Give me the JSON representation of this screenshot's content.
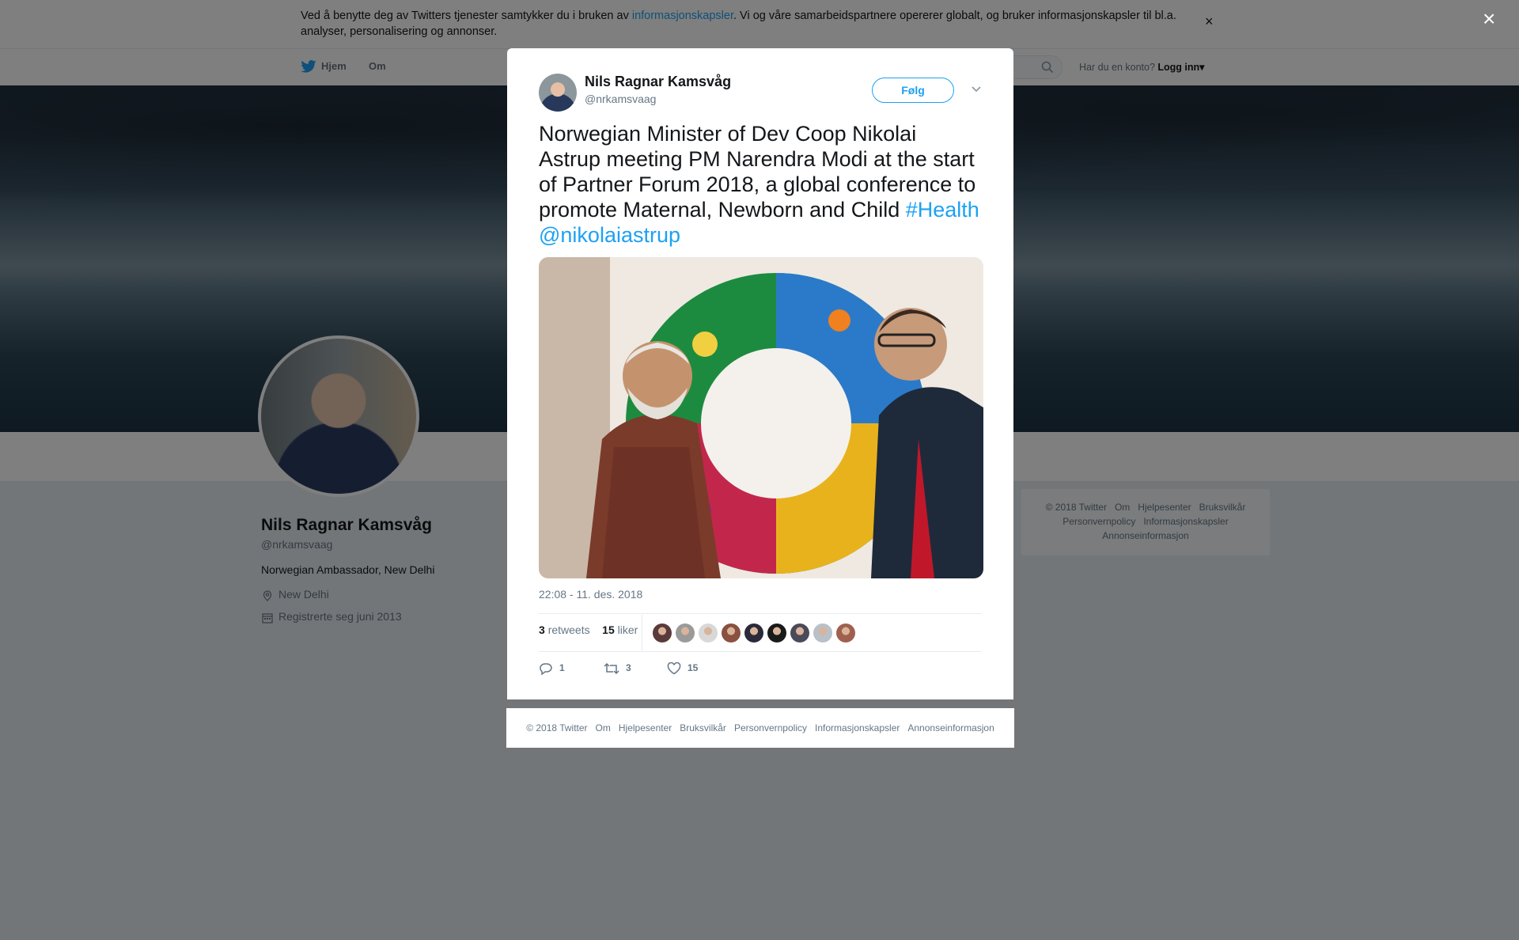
{
  "cookie_banner": {
    "text_before": "Ved å benytte deg av Twitters tjenester samtykker du i bruken av ",
    "link": "informasjonskapsler",
    "text_after": ". Vi og våre samarbeidspartnere opererer globalt, og bruker informasjonskapsler til bl.a. analyser, personalisering og annonser.",
    "close": "×"
  },
  "nav": {
    "home": "Hjem",
    "about": "Om",
    "have_account": "Har du en konto?",
    "login": "Logg inn",
    "login_caret": "▾"
  },
  "profile": {
    "name": "Nils Ragnar Kamsvåg",
    "handle": "@nrkamsvaag",
    "bio": "Norwegian Ambassador, New Delhi",
    "location": "New Delhi",
    "joined": "Registrerte seg juni 2013"
  },
  "right_footer": [
    "© 2018 Twitter",
    "Om",
    "Hjelpesenter",
    "Bruksvilkår",
    "Personvernpolicy",
    "Informasjonskapsler",
    "Annonseinformasjon"
  ],
  "overlay_close": "×",
  "tweet": {
    "author_name": "Nils Ragnar Kamsvåg",
    "author_handle": "@nrkamsvaag",
    "follow_label": "Følg",
    "text": "Norwegian Minister of Dev Coop Nikolai Astrup meeting PM Narendra Modi at the start of Partner Forum 2018, a global conference to promote Maternal, Newborn and Child ",
    "hashtag": "#Health",
    "mention": "@nikolaiastrup",
    "timestamp": "22:08 - 11. des. 2018",
    "retweets_count": "3",
    "retweets_label": "retweets",
    "likes_count": "15",
    "likes_label": "liker",
    "reply_count": "1",
    "retweet_count": "3",
    "like_count": "15"
  },
  "liker_avatar_colors": [
    "#5b3a3a",
    "#9a9a9a",
    "#d8d8d8",
    "#8a5040",
    "#2a2a3a",
    "#1a1a1a",
    "#4a4a5a",
    "#b8c0c8",
    "#a06050"
  ],
  "modal_footer": [
    "© 2018 Twitter",
    "Om",
    "Hjelpesenter",
    "Bruksvilkår",
    "Personvernpolicy",
    "Informasjonskapsler",
    "Annonseinformasjon"
  ],
  "colors": {
    "accent": "#1da1f2",
    "text": "#14171a",
    "muted": "#657786",
    "page_bg": "#e6ecf0"
  }
}
